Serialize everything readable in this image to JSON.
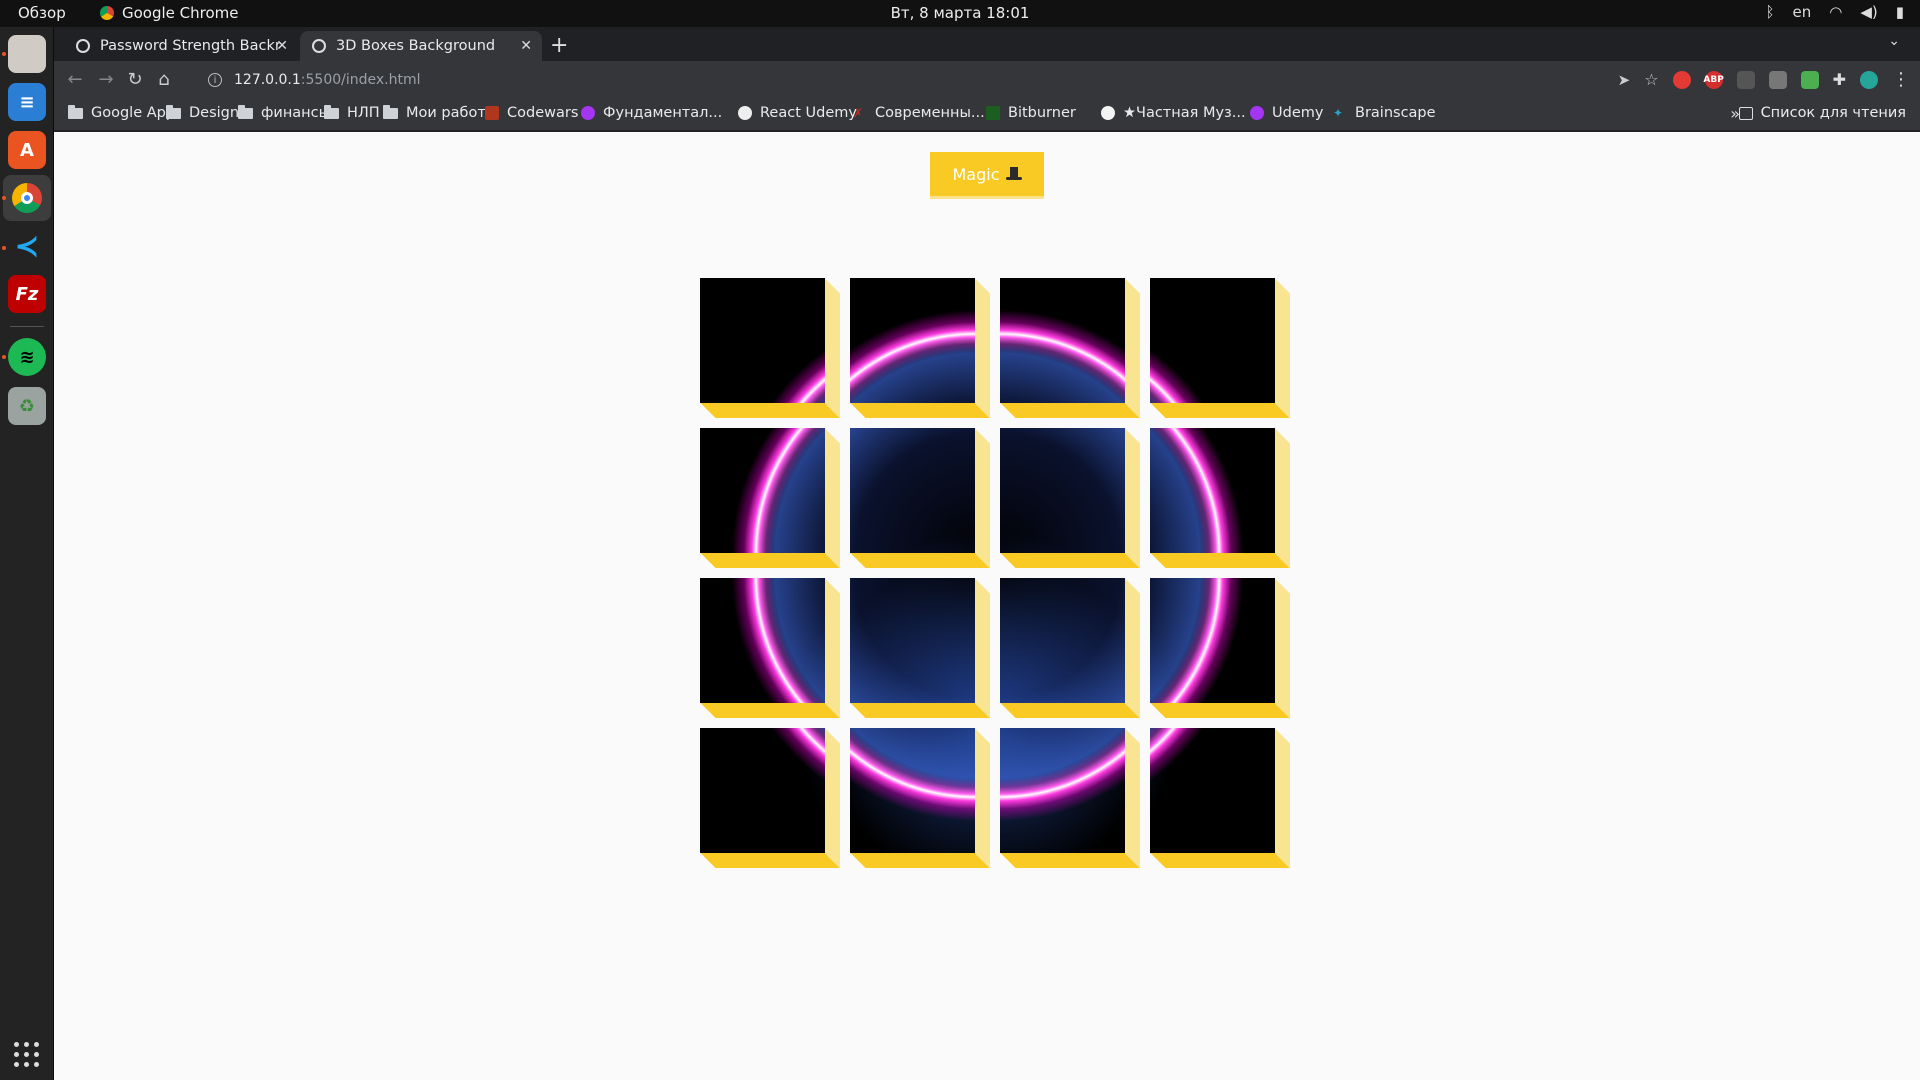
{
  "topbar": {
    "overview": "Обзор",
    "app_name": "Google Chrome",
    "clock": "Вт, 8 марта  18:01",
    "lang": "en"
  },
  "dock": {
    "items": [
      "files-icon",
      "libreoffice-writer-icon",
      "software-center-icon",
      "chrome-icon",
      "vscode-icon",
      "filezilla-icon",
      "spotify-icon",
      "trash-icon"
    ]
  },
  "browser": {
    "tabs": [
      {
        "title": "Password Strength Backr"
      },
      {
        "title": "3D Boxes Background"
      }
    ],
    "url_host": "127.0.0.1",
    "url_path": ":5500/index.html",
    "extensions": [
      {
        "label": "",
        "color": "#e53935"
      },
      {
        "label": "ABP",
        "color": "#d32f2f"
      },
      {
        "label": "",
        "color": "#555"
      },
      {
        "label": "",
        "color": "#777"
      },
      {
        "label": "",
        "color": "#4caf50"
      },
      {
        "label": "",
        "color": "#3a3a3a"
      },
      {
        "label": "",
        "color": "#26a69a"
      }
    ],
    "bookmarks": [
      {
        "label": "Google App",
        "icon": "folder"
      },
      {
        "label": "Design",
        "icon": "folder"
      },
      {
        "label": "финансы",
        "icon": "folder"
      },
      {
        "label": "НЛП",
        "icon": "folder"
      },
      {
        "label": "Мои работы",
        "icon": "folder"
      },
      {
        "label": "Codewars",
        "icon": "#b1361e"
      },
      {
        "label": "Фундаментал...",
        "icon": "#a435f0"
      },
      {
        "label": "React Udemy",
        "icon": "#eeeeee"
      },
      {
        "label": "Современны...",
        "icon": "#c62828"
      },
      {
        "label": "Bitburner",
        "icon": "#1b5e20"
      },
      {
        "label": "★Частная Муз...",
        "icon": "#f4f4f4"
      },
      {
        "label": "Udemy",
        "icon": "#a435f0"
      },
      {
        "label": "Brainscape",
        "icon": "#2aa0c9"
      }
    ],
    "more_bookmarks": "»",
    "reading_list": "Список для чтения"
  },
  "page": {
    "magic_label": "Magic",
    "grid": {
      "rows": 4,
      "cols": 4
    },
    "colors": {
      "button": "#f9ca24",
      "side_light": "#f9e492",
      "side_bottom": "#f6e58d"
    }
  }
}
